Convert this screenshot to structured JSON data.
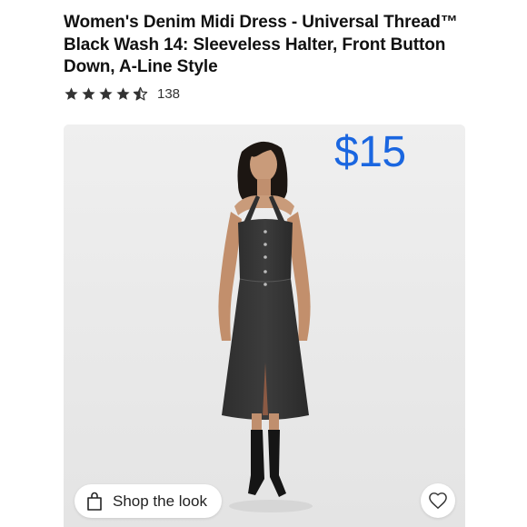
{
  "product": {
    "title": "Women's Denim Midi Dress - Universal Thread™ Black Wash 14: Sleeveless Halter, Front Button Down, A-Line Style",
    "rating": {
      "stars": 4.5,
      "max_stars": 5,
      "count": "138"
    },
    "price": "$15",
    "image_alt": "Model wearing black wash denim halter midi dress with cowboy boots"
  },
  "actions": {
    "shop_the_look_label": "Shop the look",
    "shop_icon": "shopping-bag-icon",
    "favorite_icon": "heart-outline-icon"
  },
  "colors": {
    "price": "#1a66e0",
    "star": "#333333",
    "card_background": "#eeeeee"
  }
}
